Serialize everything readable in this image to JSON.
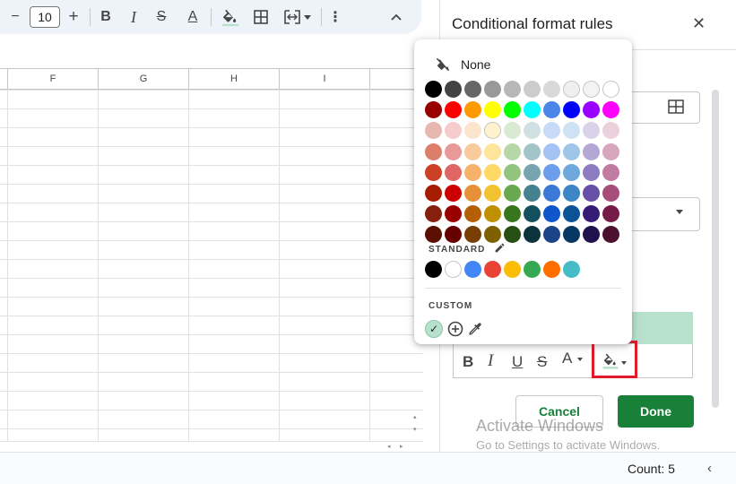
{
  "toolbar": {
    "font_size": "10",
    "decrease_label": "−",
    "increase_label": "+",
    "bold_label": "B",
    "italic_label": "I",
    "strike_label": "S",
    "text_color_label": "A",
    "more_label": "⋮",
    "collapse_label": "︿"
  },
  "grid": {
    "columns": [
      "F",
      "G",
      "H",
      "I"
    ]
  },
  "status": {
    "count_label": "Count: 5",
    "collapse_arrow": "‹"
  },
  "panel": {
    "title": "Conditional format rules",
    "close_label": "✕",
    "format_buttons": [
      "B",
      "I",
      "U",
      "S",
      "A"
    ],
    "cancel_label": "Cancel",
    "done_label": "Done"
  },
  "picker": {
    "none_label": "None",
    "standard_label": "STANDARD",
    "custom_label": "CUSTOM",
    "palette_rows": [
      [
        "#000000",
        "#434343",
        "#666666",
        "#999999",
        "#b7b7b7",
        "#cccccc",
        "#d9d9d9",
        "#efefef",
        "#f3f3f3",
        "#ffffff"
      ],
      [
        "#980000",
        "#ff0000",
        "#ff9900",
        "#ffff00",
        "#00ff00",
        "#00ffff",
        "#4a86e8",
        "#0000ff",
        "#9900ff",
        "#ff00ff"
      ],
      [
        "#e6b8af",
        "#f4cccc",
        "#fce5cd",
        "#fff2cc",
        "#d9ead3",
        "#d0e0e3",
        "#c9daf8",
        "#cfe2f3",
        "#d9d2e9",
        "#ead1dc"
      ],
      [
        "#dd7e6b",
        "#ea9999",
        "#f9cb9c",
        "#ffe599",
        "#b6d7a8",
        "#a2c4c9",
        "#a4c2f4",
        "#9fc5e8",
        "#b4a7d6",
        "#d5a6bd"
      ],
      [
        "#cc4125",
        "#e06666",
        "#f6b26b",
        "#ffd966",
        "#93c47d",
        "#76a5af",
        "#6d9eeb",
        "#6fa8dc",
        "#8e7cc3",
        "#c27ba0"
      ],
      [
        "#a61c00",
        "#cc0000",
        "#e69138",
        "#f1c232",
        "#6aa84f",
        "#45818e",
        "#3c78d8",
        "#3d85c6",
        "#674ea7",
        "#a64d79"
      ],
      [
        "#85200c",
        "#990000",
        "#b45f06",
        "#bf9000",
        "#38761d",
        "#134f5c",
        "#1155cc",
        "#0b5394",
        "#351c75",
        "#741b47"
      ],
      [
        "#5b0f00",
        "#660000",
        "#783f04",
        "#7f6000",
        "#274e13",
        "#0c343d",
        "#1c4587",
        "#073763",
        "#20124d",
        "#4c1130"
      ]
    ],
    "standard_colors": [
      "#000000",
      "#ffffff",
      "#4285f4",
      "#ea4335",
      "#fbbc04",
      "#34a853",
      "#ff6d01",
      "#46bdc6"
    ],
    "custom_colors": [
      "#b7e1cd"
    ],
    "custom_check": "✓"
  },
  "watermark": {
    "title": "Activate Windows",
    "subtitle": "Go to Settings to activate Windows."
  }
}
